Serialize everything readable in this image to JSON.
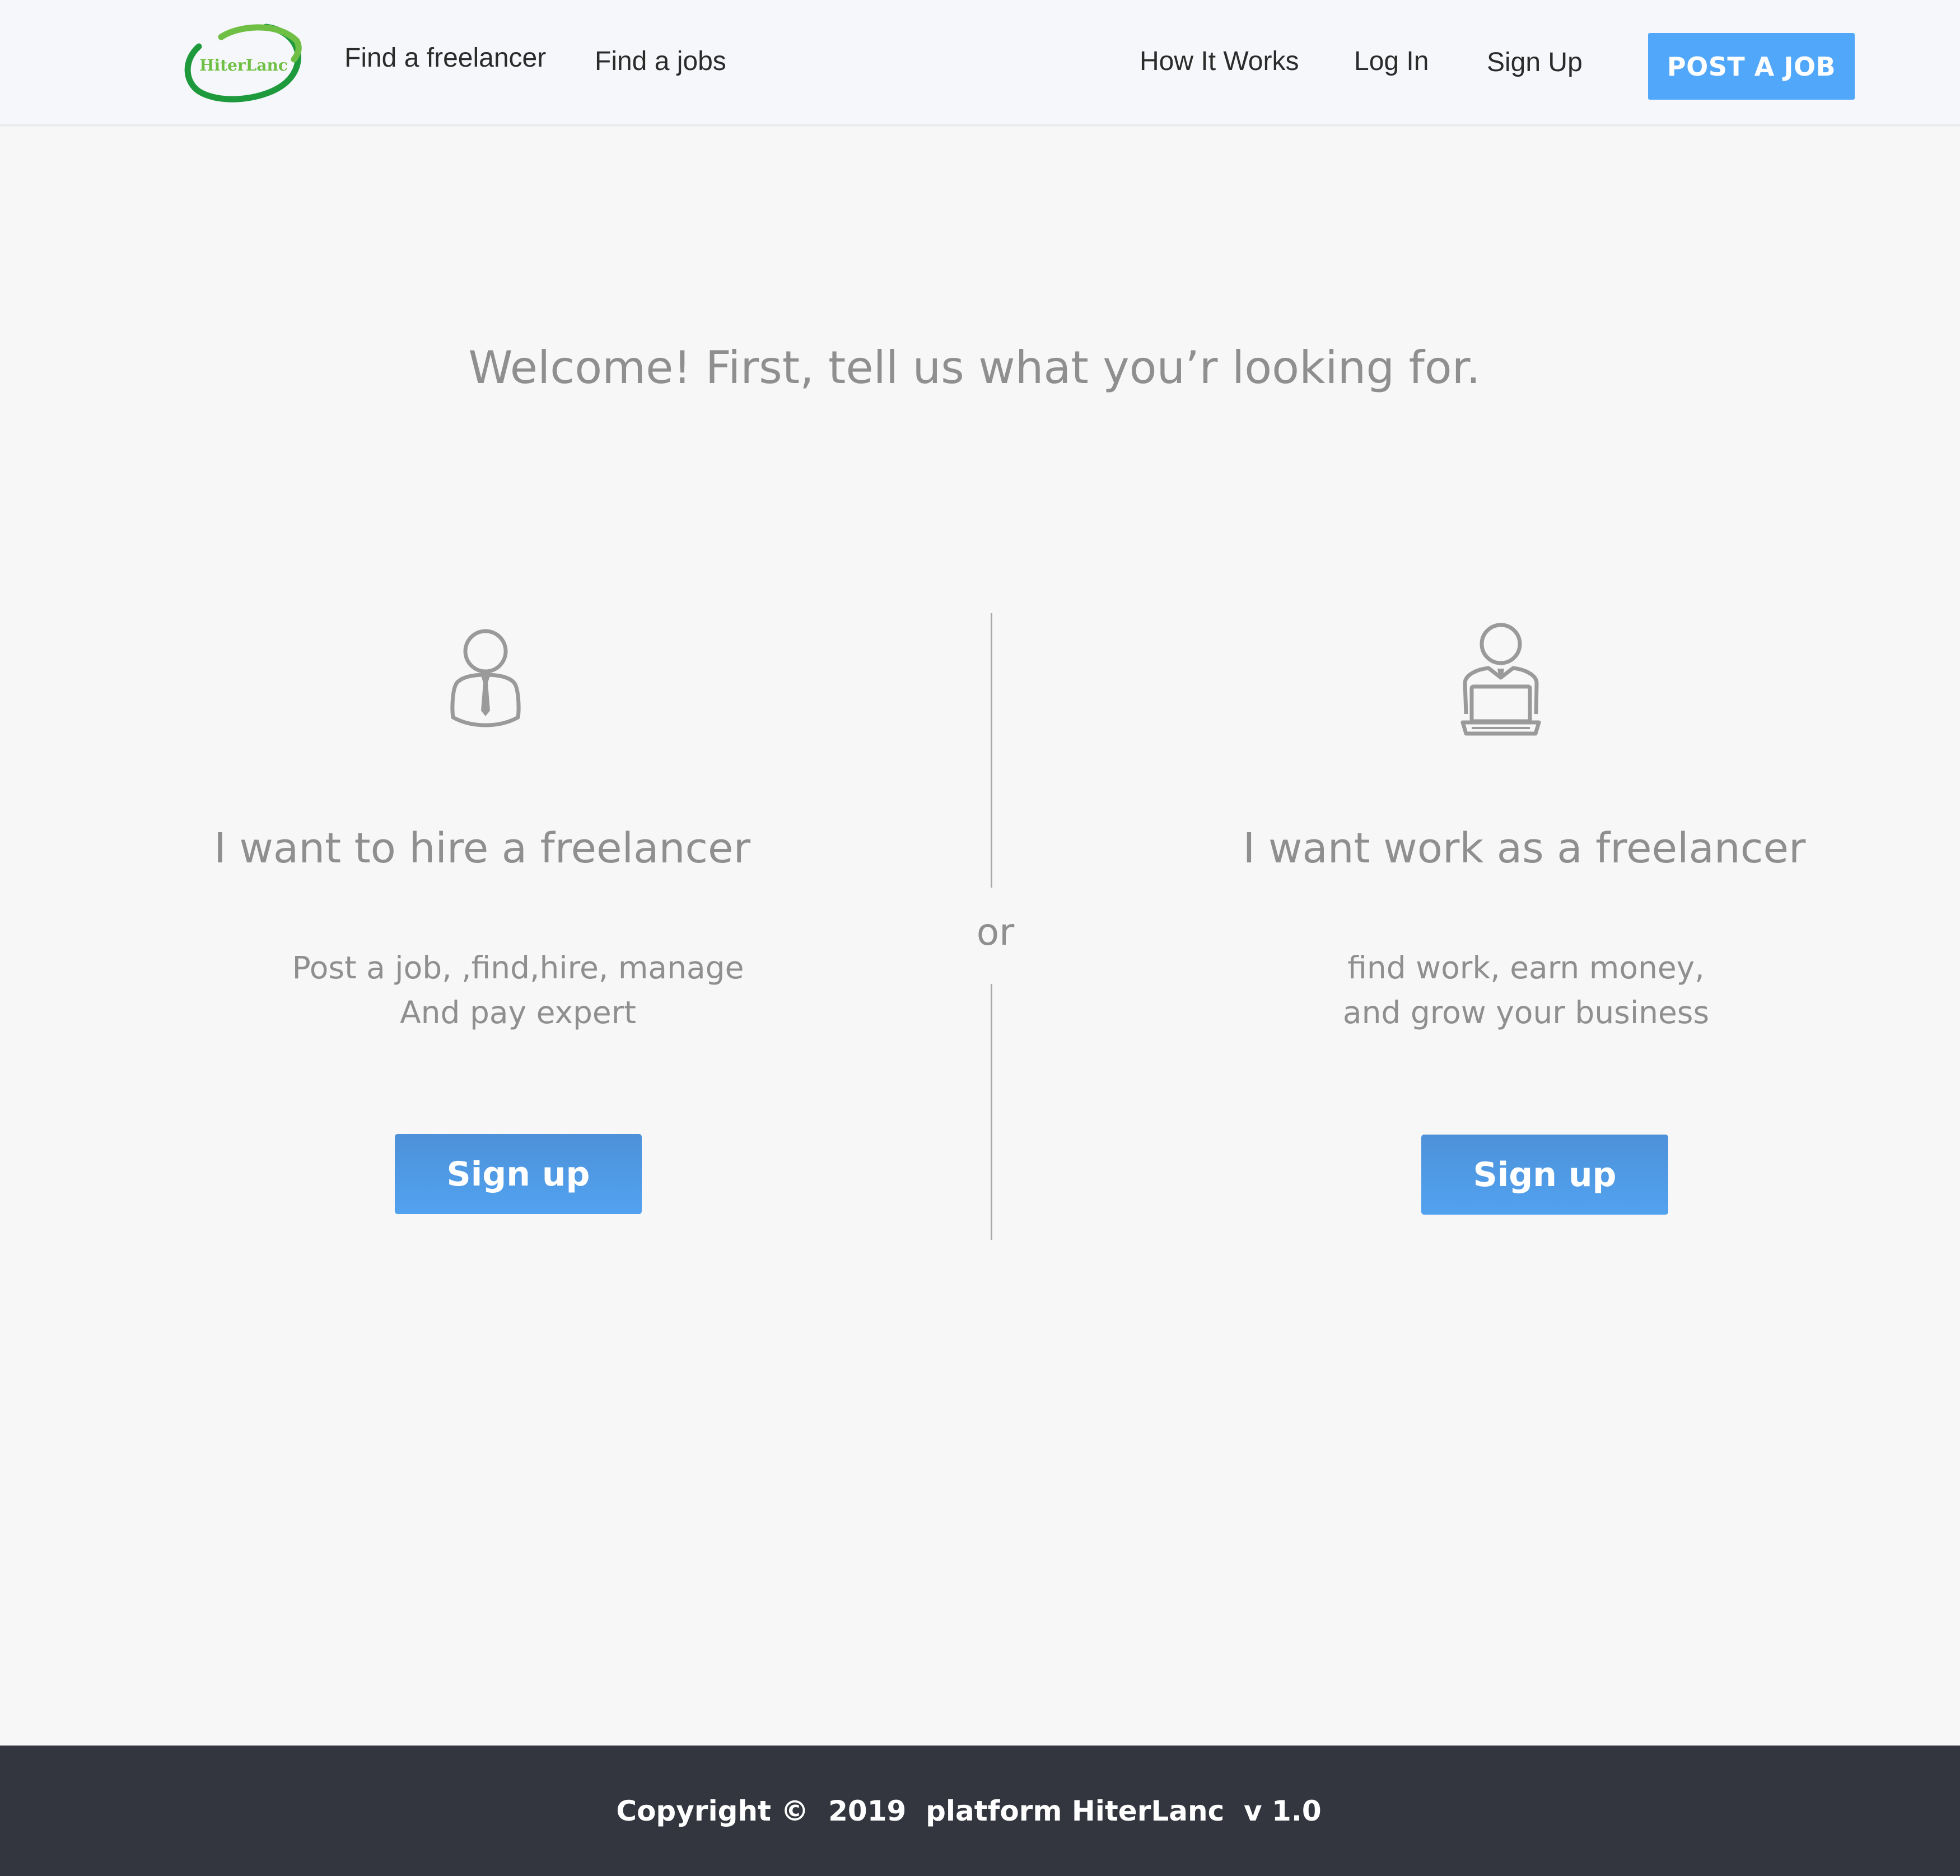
{
  "header": {
    "logo_text": "HiterLanc",
    "nav_left": [
      "Find a freelancer",
      "Find a jobs"
    ],
    "nav_right": [
      "How It Works",
      "Log In",
      "Sign Up"
    ],
    "post_job_label": "POST A JOB"
  },
  "main": {
    "welcome": "Welcome! First, tell us what you’r looking for.",
    "or_label": "or",
    "hire": {
      "icon": "businessman-tie-icon",
      "title": "I want to hire a freelancer",
      "desc": [
        "Post a job, ,find,hire, manage",
        "And pay expert"
      ],
      "button": "Sign up"
    },
    "work": {
      "icon": "person-laptop-icon",
      "title": "I want work as a freelancer",
      "desc": [
        "find work, earn money,",
        "and grow your business"
      ],
      "button": "Sign up"
    }
  },
  "footer": {
    "copyright": "Copyright ©  2019  platform HiterLanc  v 1.0"
  },
  "colors": {
    "accent": "#51a7fa",
    "button": "#4f99e6",
    "footer_bg": "#33363f",
    "muted_text": "#8f8f8f",
    "logo_green": "#1e9a3d",
    "logo_light_green": "#6fbf44"
  }
}
